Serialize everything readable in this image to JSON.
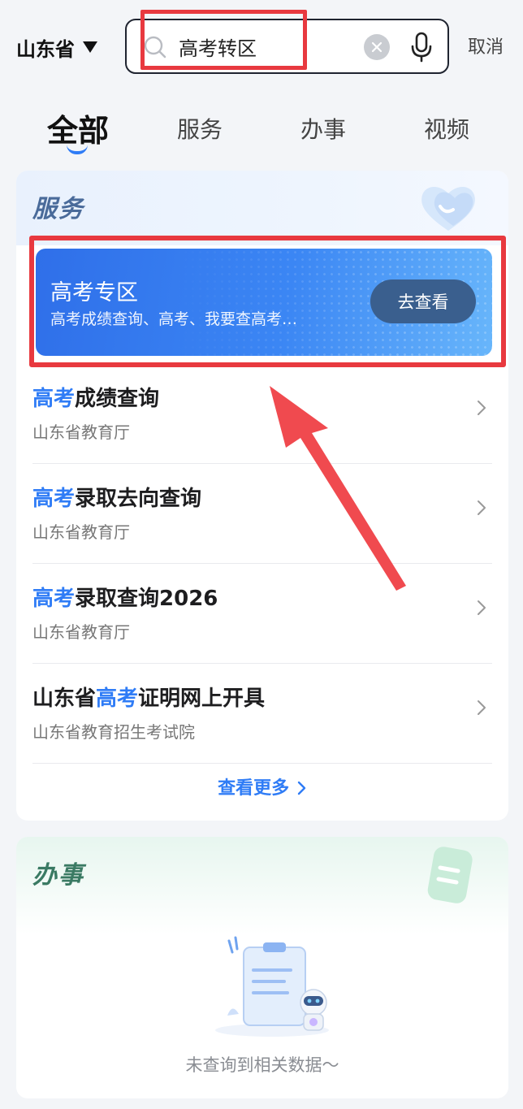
{
  "header": {
    "region": "山东省",
    "search": {
      "value": "高考转区",
      "placeholder": ""
    },
    "cancel": "取消"
  },
  "tabs": [
    {
      "label": "全部",
      "active": true
    },
    {
      "label": "服务",
      "active": false
    },
    {
      "label": "办事",
      "active": false
    },
    {
      "label": "视频",
      "active": false
    }
  ],
  "services": {
    "title": "服务",
    "banner": {
      "title": "高考专区",
      "subtitle": "高考成绩查询、高考、我要查高考…",
      "button": "去查看"
    },
    "items": [
      {
        "pre": "",
        "hl": "高考",
        "post": "成绩查询",
        "org": "山东省教育厅"
      },
      {
        "pre": "",
        "hl": "高考",
        "post": "录取去向查询",
        "org": "山东省教育厅"
      },
      {
        "pre": "",
        "hl": "高考",
        "post": "录取查询2026",
        "org": "山东省教育厅"
      },
      {
        "pre": "山东省",
        "hl": "高考",
        "post": "证明网上开具",
        "org": "山东省教育招生考试院"
      }
    ],
    "more": "查看更多"
  },
  "affairs": {
    "title": "办事",
    "empty_text": "未查询到相关数据～"
  },
  "colors": {
    "accent": "#2f7cf6",
    "annotation": "#e8393f",
    "banner_button": "#3a5f8e"
  }
}
